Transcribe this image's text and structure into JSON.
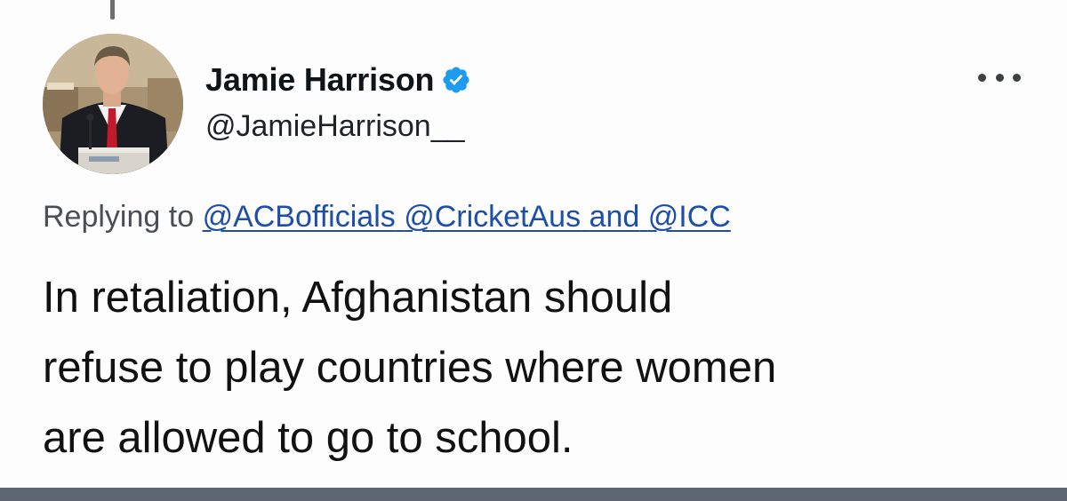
{
  "tweet": {
    "author": {
      "display_name": "Jamie Harrison",
      "handle": "@JamieHarrison__",
      "verified": true,
      "avatar_icon": "person-at-podium-photo"
    },
    "more_icon": "more-dots-icon",
    "reply": {
      "prefix": "Replying to",
      "mentions": [
        "@ACBofficials",
        "@CricketAus",
        "@ICC"
      ],
      "conjunction": "and"
    },
    "text_lines": [
      "In retaliation, Afghanistan should",
      "refuse to play countries where women",
      "are allowed to go to school."
    ]
  },
  "colors": {
    "link": "#1d4fa8",
    "verified_badge": "#1d9bf0",
    "bottom_bar": "#5f6673"
  }
}
